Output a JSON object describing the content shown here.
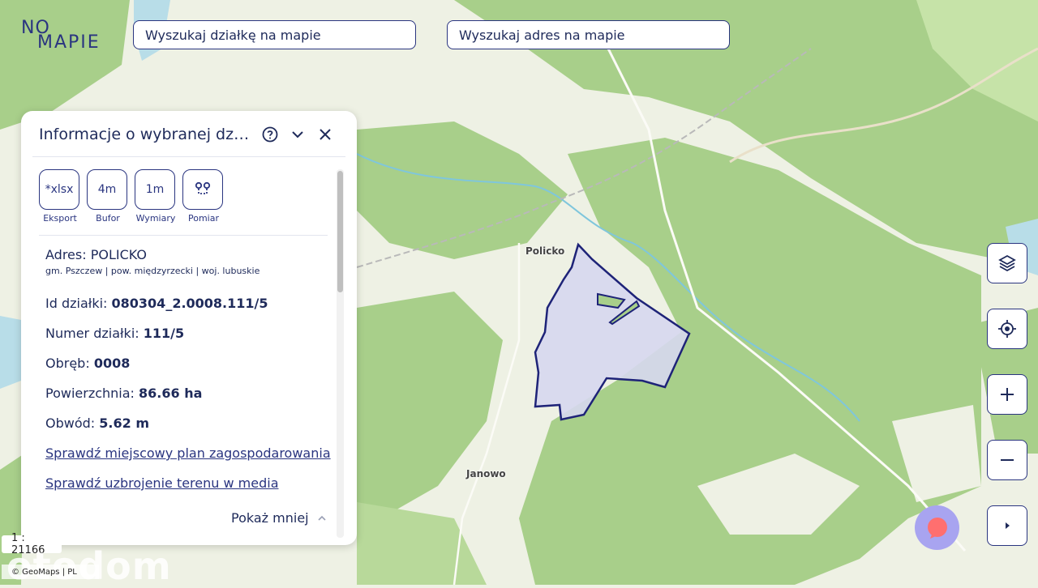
{
  "colors": {
    "accent": "#2a3580",
    "forest": "#a8cf8a",
    "meadow": "#eef1e4",
    "parcel_fill": "#d6d7ee",
    "parcel_stroke": "#1e2378",
    "chat": "#a8a4f0"
  },
  "logo": {
    "line1": "NO",
    "line2": "MAPIE"
  },
  "search": {
    "parcel_placeholder": "Wyszukaj działkę na mapie",
    "address_placeholder": "Wyszukaj adres na mapie"
  },
  "panel": {
    "title": "Informacje o wybranej działce",
    "tools": [
      {
        "icon": "xlsx",
        "text": "*xlsx",
        "label": "Eksport"
      },
      {
        "icon": "buffer",
        "text": "4m",
        "label": "Bufor"
      },
      {
        "icon": "ruler",
        "text": "1m",
        "label": "Wymiary"
      },
      {
        "icon": "route",
        "text": "",
        "label": "Pomiar"
      }
    ],
    "address_label": "Adres: POLICKO",
    "address_sub": "gm. Pszczew | pow. międzyrzecki | woj. lubuskie",
    "rows": [
      {
        "label": "Id działki:",
        "value": "080304_2.0008.111/5"
      },
      {
        "label": "Numer działki:",
        "value": "111/5"
      },
      {
        "label": "Obręb:",
        "value": "0008"
      },
      {
        "label": "Powierzchnia:",
        "value": "86.66 ha"
      },
      {
        "label": "Obwód:",
        "value": "5.62 m"
      }
    ],
    "links": [
      "Sprawdź miejscowy plan zagospodarowania",
      "Sprawdź uzbrojenie terenu w media"
    ],
    "collapse_label": "Pokaż mniej"
  },
  "map": {
    "places": [
      "Policko",
      "Janowo"
    ],
    "scale": "1 : 21166",
    "attribution": "© GeoMaps | PL",
    "watermark": "otodom"
  },
  "controls": [
    "layers-icon",
    "locate-icon",
    "zoom-in-icon",
    "zoom-out-icon",
    "expand-icon"
  ]
}
